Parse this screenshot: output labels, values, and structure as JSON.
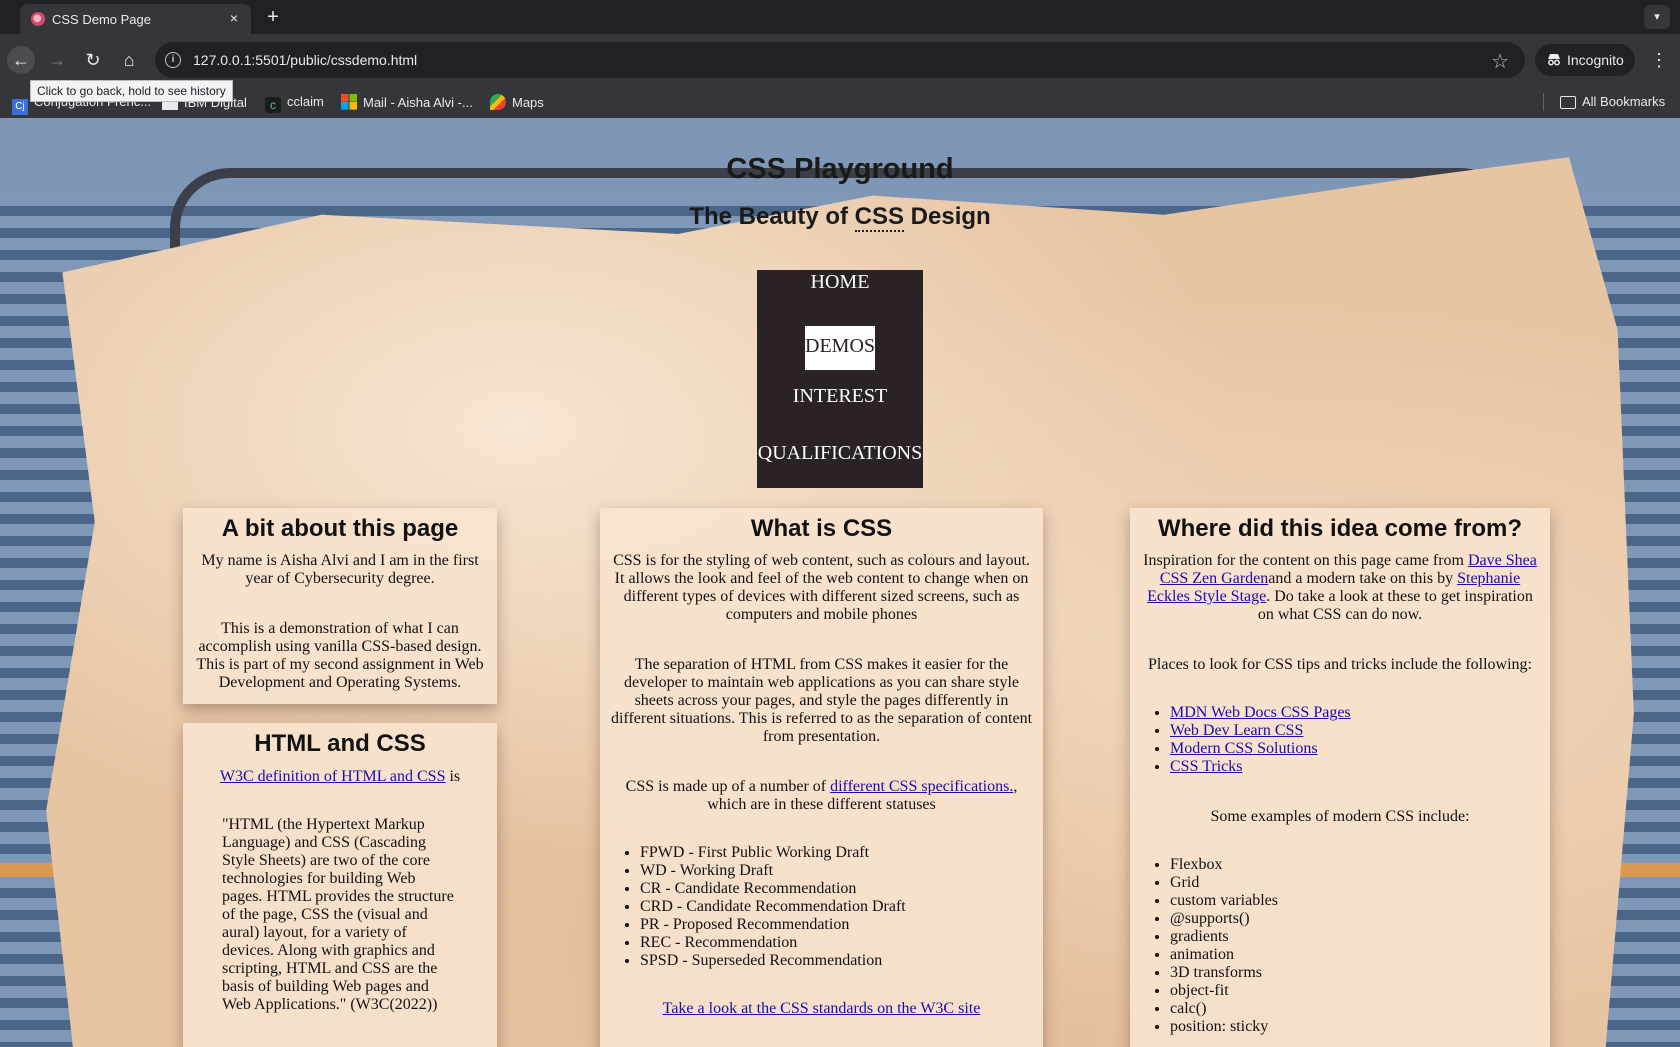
{
  "browser": {
    "tab_title": "CSS Demo Page",
    "tab_close": "×",
    "new_tab": "+",
    "url": "127.0.0.1:5501/public/cssdemo.html",
    "incognito_label": "Incognito",
    "tooltip": "Click to go back, hold to see history",
    "bookmarks": [
      {
        "label": "Conjugation Frenc...",
        "icon": "cj-icon"
      },
      {
        "label": "IBM Digital",
        "icon": "ibm-icon"
      },
      {
        "label": "cclaim",
        "icon": "cclaim-icon"
      },
      {
        "label": "Mail - Aisha Alvi -...",
        "icon": "microsoft-icon"
      },
      {
        "label": "Maps",
        "icon": "maps-icon"
      }
    ],
    "all_bookmarks": "All Bookmarks"
  },
  "page": {
    "title": "CSS Playground",
    "subtitle_before": "The Beauty of ",
    "subtitle_abbr": "CSS",
    "subtitle_after": " Design",
    "nav": [
      "HOME",
      "DEMOS",
      "INTEREST",
      "QUALIFICATIONS"
    ],
    "about": {
      "heading": "A bit about this page",
      "p1": "My name is Aisha Alvi and I am in the first year of Cybersecurity degree.",
      "p2": "This is a demonstration of what I can accomplish using vanilla CSS-based design. This is part of my second assignment in Web Development and Operating Systems."
    },
    "htmlcss": {
      "heading": "HTML and CSS",
      "link": "W3C definition of HTML and CSS",
      "link_suffix": " is",
      "quote": "\"HTML (the Hypertext Markup Language) and CSS (Cascading Style Sheets) are two of the core technologies for building Web pages. HTML provides the structure of the page, CSS the (visual and aural) layout, for a variety of devices. Along with graphics and scripting, HTML and CSS are the basis of building Web pages and Web Applications.\" (W3C(2022))"
    },
    "what": {
      "heading": "What is CSS",
      "p1": "CSS is for the styling of web content, such as colours and layout. It allows the look and feel of the web content to change when on different types of devices with different sized screens, such as computers and mobile phones",
      "p2": "The separation of HTML from CSS makes it easier for the developer to maintain web applications as you can share style sheets across your pages, and style the pages differently in different situations. This is referred to as the separation of content from presentation.",
      "p3_before": "CSS is made up of a number of ",
      "p3_link": "different CSS specifications.",
      "p3_after": ", which are in these different statuses",
      "statuses": [
        "FPWD - First Public Working Draft",
        "WD - Working Draft",
        "CR - Candidate Recommendation",
        "CRD - Candidate Recommendation Draft",
        "PR - Proposed Recommendation",
        "REC - Recommendation",
        "SPSD - Superseded Recommendation"
      ],
      "standards_link": "Take a look at the CSS standards on the W3C site"
    },
    "where": {
      "heading": "Where did this idea come from?",
      "p1_before": "Inspiration for the content on this page came from ",
      "p1_link1": "Dave Shea CSS Zen Garden",
      "p1_mid": "and a modern take on this by ",
      "p1_link2": "Stephanie Eckles Style Stage",
      "p1_after": ". Do take a look at these to get inspiration on what CSS can do now.",
      "p2": "Places to look for CSS tips and tricks include the following:",
      "tips": [
        "MDN Web Docs CSS Pages",
        "Web Dev Learn CSS",
        "Modern CSS Solutions",
        "CSS Tricks"
      ],
      "p3": "Some examples of modern CSS include:",
      "examples": [
        "Flexbox",
        "Grid",
        "custom variables",
        "@supports()",
        "gradients",
        "animation",
        "3D transforms",
        "object-fit",
        "calc()",
        "position: sticky"
      ]
    }
  },
  "colors": {
    "nav_bg": "#2a2224",
    "link": "#1a0dab",
    "card_bg": "#f8e3cd"
  }
}
